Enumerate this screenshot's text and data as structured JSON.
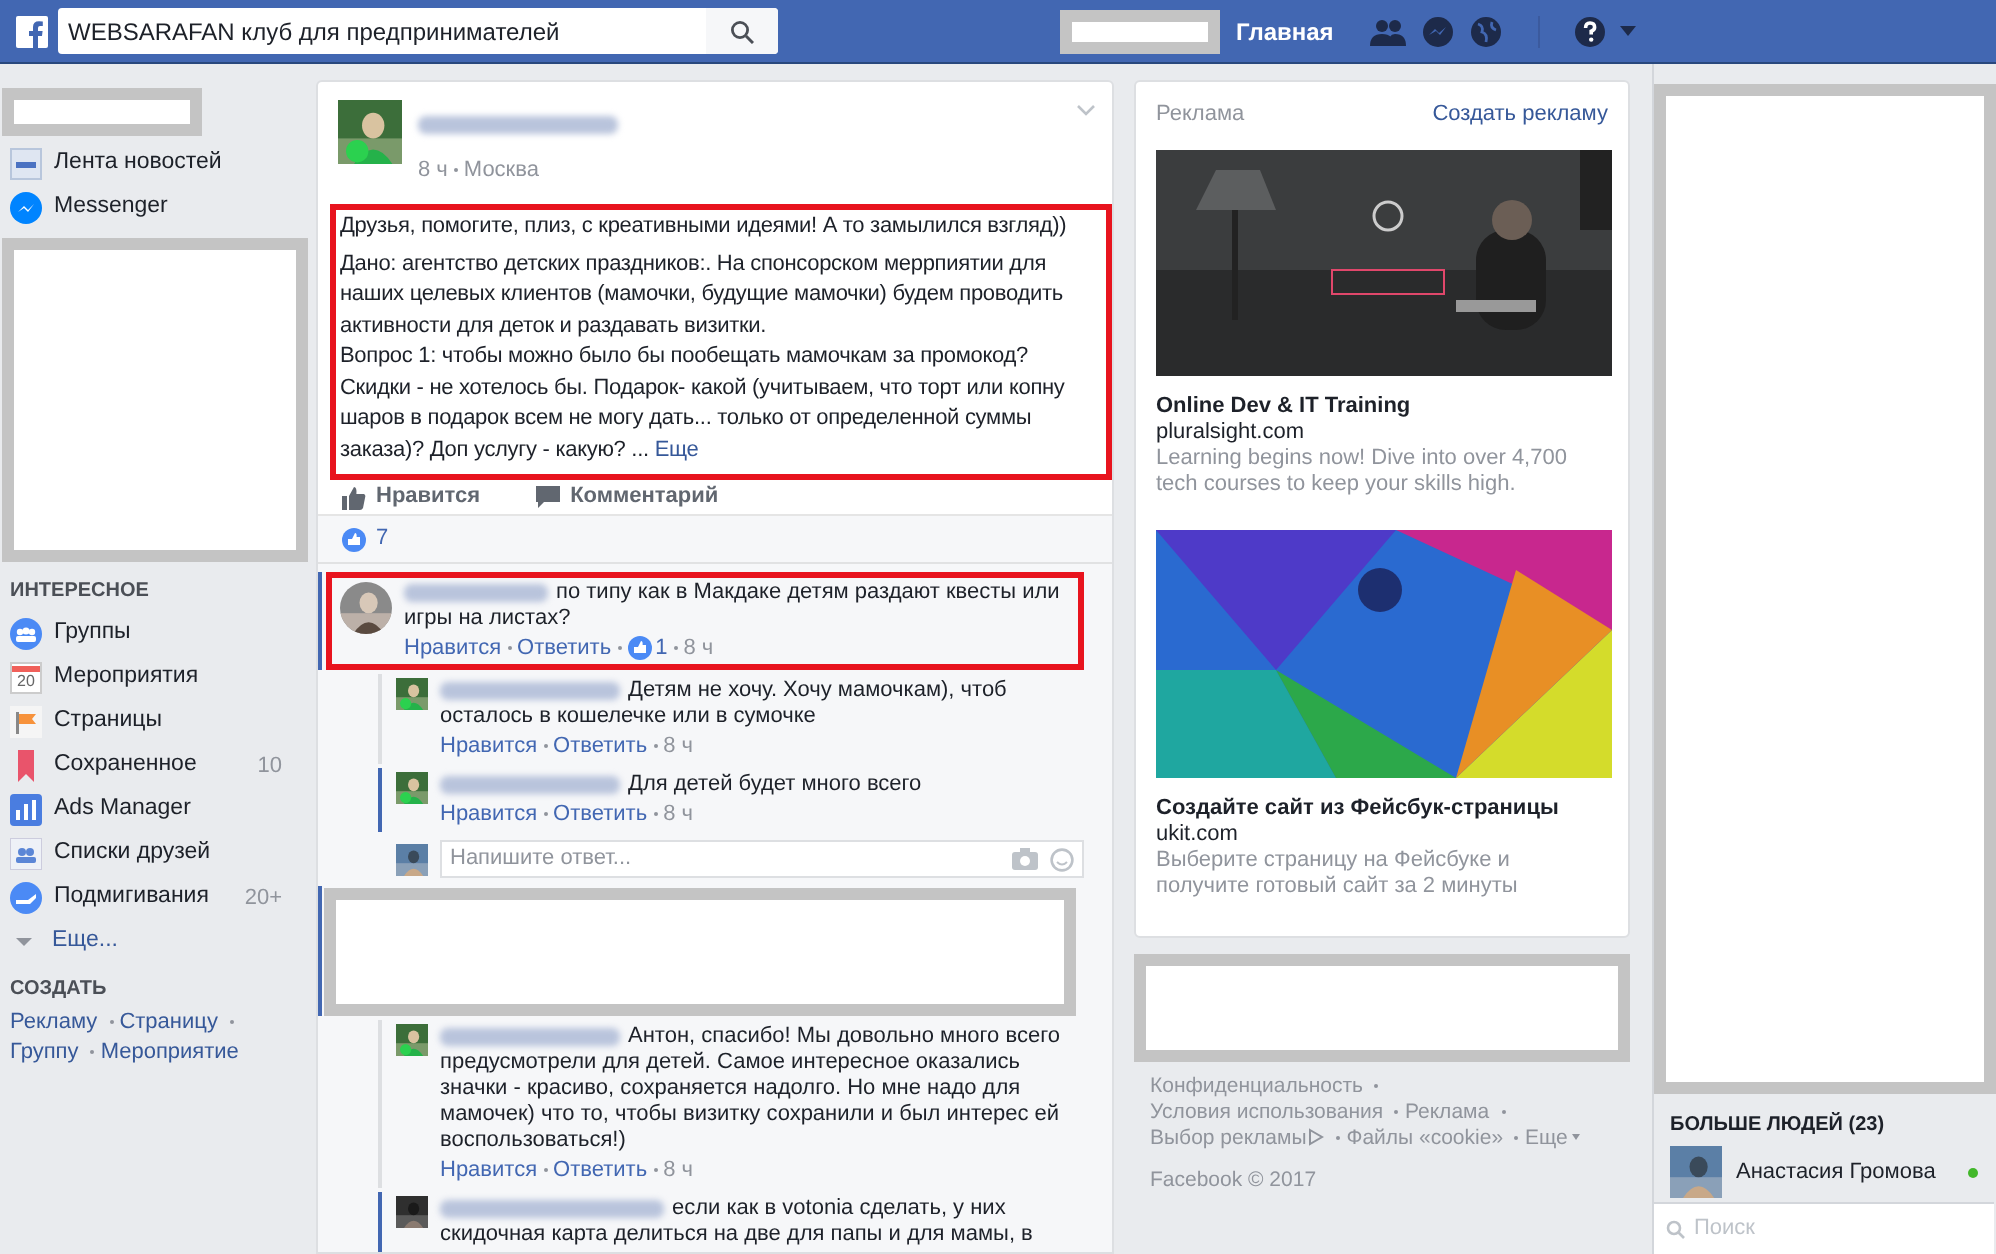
{
  "topbar": {
    "search": "WEBSARAFAN клуб для предпринимателей",
    "home": "Главная"
  },
  "sidebar": {
    "top_items": [
      {
        "label": "Лента новостей",
        "kind": "news"
      },
      {
        "label": "Messenger",
        "kind": "messenger"
      }
    ],
    "interest_heading": "ИНТЕРЕСНОЕ",
    "interest_items": [
      {
        "label": "Группы",
        "kind": "groups"
      },
      {
        "label": "Мероприятия",
        "kind": "events",
        "icon_text": "20"
      },
      {
        "label": "Страницы",
        "kind": "pages"
      },
      {
        "label": "Сохраненное",
        "kind": "saved",
        "count": "10"
      },
      {
        "label": "Ads Manager",
        "kind": "ads"
      },
      {
        "label": "Списки друзей",
        "kind": "friends"
      },
      {
        "label": "Подмигивания",
        "kind": "pokes",
        "count": "20+"
      }
    ],
    "more": "Еще...",
    "create_heading": "СОЗДАТЬ",
    "create_links": [
      "Рекламу",
      "Страницу",
      "Группу",
      "Мероприятие"
    ]
  },
  "post": {
    "time": "8 ч",
    "location": "Москва",
    "text": "Друзья, помогите, плиз, с креативными идеями! А то замылился взгляд))",
    "text2": "Дано: агентство детских праздников:. На спонсорском меррпиятии для наших целевых клиентов (мамочки, будущие мамочки) будем проводить активности для деток и раздавать визитки.\nВопрос 1: чтобы можно было бы пообещать мамочкам за промокод? Скидки - не хотелось бы. Подарок- какой (учитываем, что торт или копну шаров в подарок всем не могу дать... только от определенной суммы заказа)? Доп услугу - какую? ...",
    "more": "Еще",
    "highlighted": true,
    "actions": [
      "Нравится",
      "Комментарий"
    ],
    "likes": "7"
  },
  "comments": [
    {
      "kind": "comment",
      "text": "по типу как в Макдаке детям раздают квесты или игры на листах?",
      "like": "Нравится",
      "reply": "Ответить",
      "reactions": "1",
      "time": "8 ч",
      "highlighted": true,
      "unread": true
    },
    {
      "kind": "reply",
      "text": "Детям не хочу. Хочу мамочкам), чтоб осталось в кошелечке или в сумочке",
      "like": "Нравится",
      "reply": "Ответить",
      "time": "8 ч",
      "highlighted": false,
      "unread": false
    },
    {
      "kind": "reply",
      "text": "Для детей будет много всего",
      "like": "Нравится",
      "reply": "Ответить",
      "time": "8 ч",
      "highlighted": false,
      "unread": true
    },
    {
      "kind": "field",
      "placeholder": "Напишите ответ..."
    },
    {
      "kind": "hidden",
      "unread": true
    },
    {
      "kind": "reply",
      "text": "Антон, спасибо! Мы довольно много всего предусмотрели для детей. Самое интересное оказались значки - красиво, сохраняется надолго. Но мне надо для мамочек) что то, чтобы визитку сохранили и был интерес ей воспользоваться!)",
      "like": "Нравится",
      "reply": "Ответить",
      "time": "8 ч",
      "highlighted": false,
      "unread": false
    },
    {
      "kind": "reply",
      "text": "если как в votonia сделать, у них скидочная карта делиться на две для папы и для мамы, в",
      "highlighted": false,
      "unread": true
    }
  ],
  "ads": {
    "heading": "Реклама",
    "create": "Создать рекламу",
    "items": [
      {
        "kind": "picture",
        "title": "Online Dev & IT Training",
        "domain": "pluralsight.com",
        "text": "Learning begins now! Dive into over 4,700 tech courses to keep your skills high."
      },
      {
        "kind": "picture",
        "title": "Создайте сайт из Фейсбук-страницы",
        "domain": "ukit.com",
        "text": "Выберите страницу на Фейсбуке и получите готовый сайт за 2 минуты"
      }
    ]
  },
  "footer": {
    "links": [
      "Конфиденциальность",
      "Условия использования",
      "Реклама",
      "Выбор рекламы",
      "Файлы «cookie»",
      "Еще"
    ],
    "copyright": "Facebook © 2017"
  },
  "chat": {
    "heading": "БОЛЬШЕ ЛЮДЕЙ (23)",
    "contacts": [
      {
        "name": "Анастасия Громова",
        "online": true
      }
    ],
    "search": {
      "placeholder": "Поиск"
    }
  }
}
